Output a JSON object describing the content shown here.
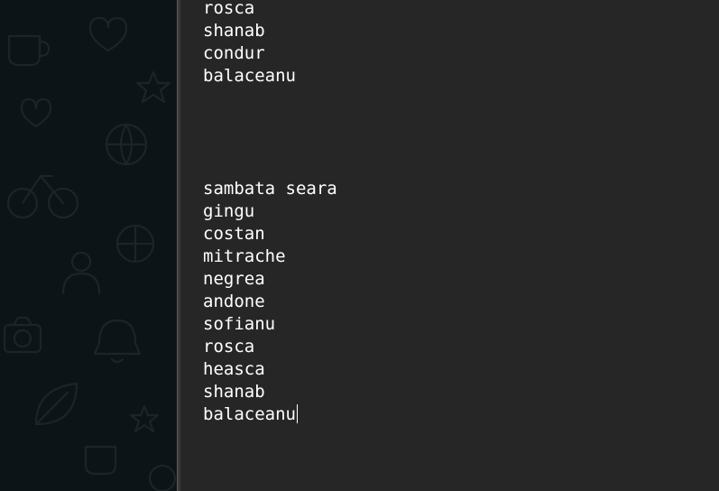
{
  "editor": {
    "lines": [
      "rosca",
      "shanab",
      "condur",
      "balaceanu",
      "",
      "",
      "",
      "",
      "sambata seara",
      "gingu",
      "costan",
      "mitrache",
      "negrea",
      "andone",
      "sofianu",
      "rosca",
      "heasca",
      "shanab",
      "balaceanu"
    ]
  },
  "colors": {
    "editor_background": "#262626",
    "text": "#ffffff",
    "wallpaper_background": "#0d1418",
    "wallpaper_doodle": "#1c2429"
  },
  "wallpaper": {
    "icons": [
      "coffee-cup-icon",
      "heart-icon",
      "star-icon",
      "bicycle-icon",
      "globe-icon",
      "person-icon",
      "camera-icon",
      "ball-icon",
      "bell-icon",
      "leaf-icon"
    ]
  }
}
